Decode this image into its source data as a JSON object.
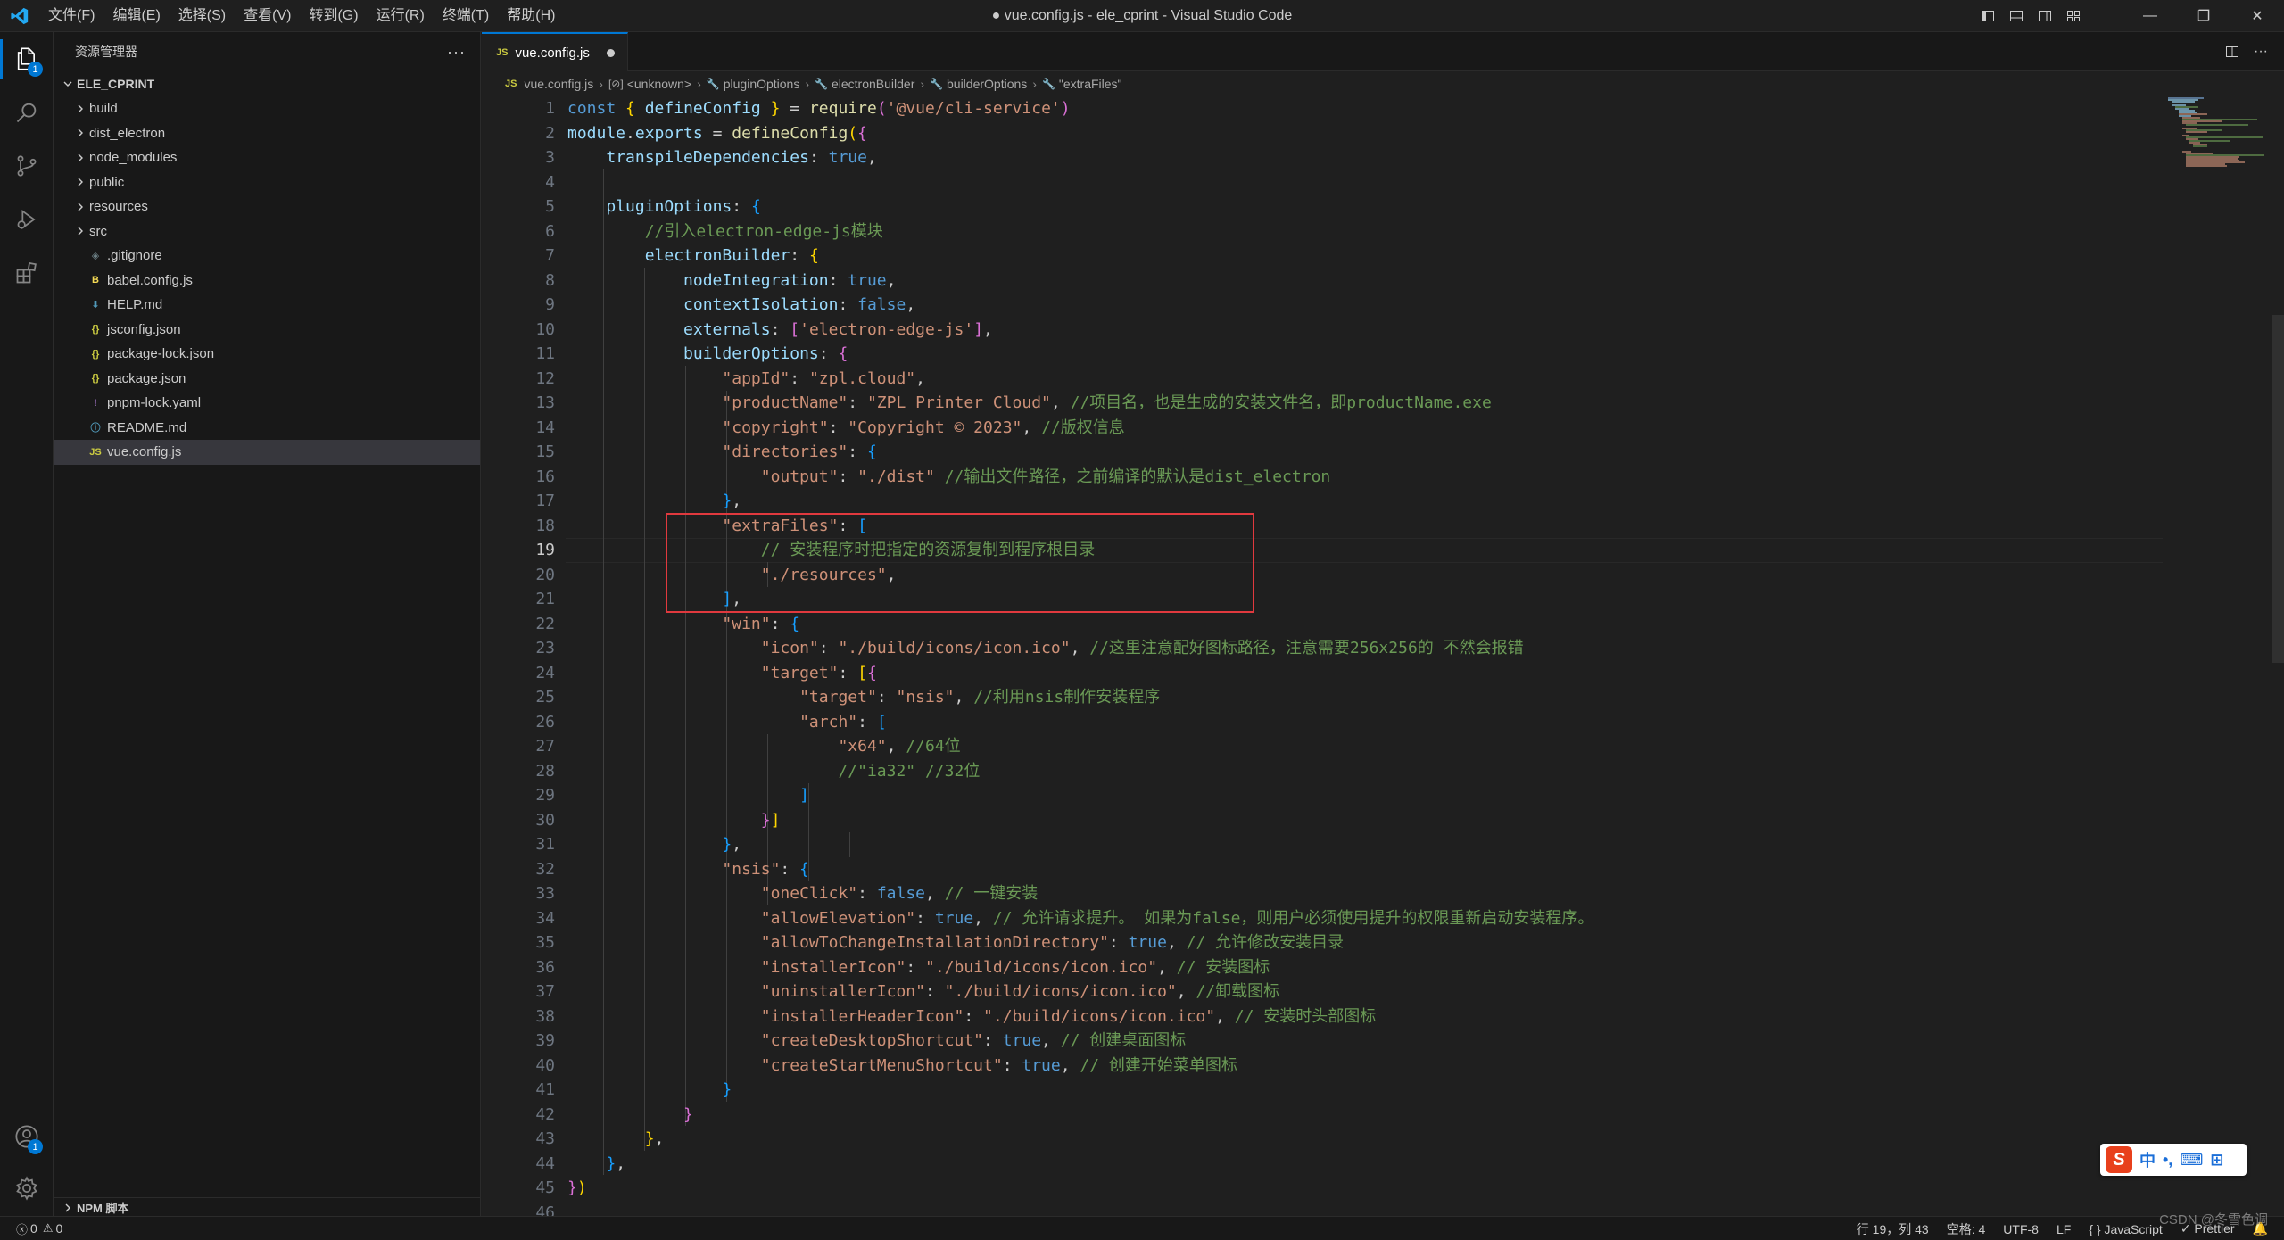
{
  "window": {
    "title": "● vue.config.js - ele_cprint - Visual Studio Code"
  },
  "menu": [
    "文件(F)",
    "编辑(E)",
    "选择(S)",
    "查看(V)",
    "转到(G)",
    "运行(R)",
    "终端(T)",
    "帮助(H)"
  ],
  "window_controls": {
    "minimize": "—",
    "maximize": "❐",
    "close": "✕"
  },
  "activity_bar": {
    "explorer_badge": "1",
    "accounts_badge": "1"
  },
  "sidebar": {
    "header": "资源管理器",
    "more": "···",
    "project": "ELE_CPRINT",
    "folders": [
      "build",
      "dist_electron",
      "node_modules",
      "public",
      "resources",
      "src"
    ],
    "files": [
      {
        "name": ".gitignore",
        "icon": "◈",
        "color": "#6d8086"
      },
      {
        "name": "babel.config.js",
        "icon": "B",
        "color": "#f5da55"
      },
      {
        "name": "HELP.md",
        "icon": "⬇",
        "color": "#519aba"
      },
      {
        "name": "jsconfig.json",
        "icon": "{}",
        "color": "#cbcb41"
      },
      {
        "name": "package-lock.json",
        "icon": "{}",
        "color": "#cbcb41"
      },
      {
        "name": "package.json",
        "icon": "{}",
        "color": "#cbcb41"
      },
      {
        "name": "pnpm-lock.yaml",
        "icon": "!",
        "color": "#a074c4"
      },
      {
        "name": "README.md",
        "icon": "ⓘ",
        "color": "#519aba"
      },
      {
        "name": "vue.config.js",
        "icon": "JS",
        "color": "#cbcb41"
      }
    ],
    "npm_section": "NPM 脚本"
  },
  "tab": {
    "badge": "JS",
    "label": "vue.config.js"
  },
  "breadcrumb": {
    "file": "vue.config.js",
    "items": [
      "<unknown>",
      "pluginOptions",
      "electronBuilder",
      "builderOptions",
      "\"extraFiles\""
    ]
  },
  "editor": {
    "active_line": 19,
    "lines": [
      [
        [
          "k",
          "const "
        ],
        [
          "b1",
          "{ "
        ],
        [
          "v",
          "defineConfig"
        ],
        [
          "b1",
          " }"
        ],
        [
          "p",
          " = "
        ],
        [
          "f",
          "require"
        ],
        [
          "b2",
          "("
        ],
        [
          "s",
          "'@vue/cli-service'"
        ],
        [
          "b2",
          ")"
        ]
      ],
      [
        [
          "v",
          "module"
        ],
        [
          "p",
          "."
        ],
        [
          "v",
          "exports"
        ],
        [
          "p",
          " = "
        ],
        [
          "f",
          "defineConfig"
        ],
        [
          "b1",
          "("
        ],
        [
          "b2",
          "{"
        ]
      ],
      [
        [
          "p",
          "    "
        ],
        [
          "v",
          "transpileDependencies"
        ],
        [
          "p",
          ": "
        ],
        [
          "k",
          "true"
        ],
        [
          "p",
          ","
        ]
      ],
      [],
      [
        [
          "p",
          "    "
        ],
        [
          "v",
          "pluginOptions"
        ],
        [
          "p",
          ": "
        ],
        [
          "b3",
          "{"
        ]
      ],
      [
        [
          "p",
          "        "
        ],
        [
          "c",
          "//引入electron-edge-js模块"
        ]
      ],
      [
        [
          "p",
          "        "
        ],
        [
          "v",
          "electronBuilder"
        ],
        [
          "p",
          ": "
        ],
        [
          "b1",
          "{"
        ]
      ],
      [
        [
          "p",
          "            "
        ],
        [
          "v",
          "nodeIntegration"
        ],
        [
          "p",
          ": "
        ],
        [
          "k",
          "true"
        ],
        [
          "p",
          ","
        ]
      ],
      [
        [
          "p",
          "            "
        ],
        [
          "v",
          "contextIsolation"
        ],
        [
          "p",
          ": "
        ],
        [
          "k",
          "false"
        ],
        [
          "p",
          ","
        ]
      ],
      [
        [
          "p",
          "            "
        ],
        [
          "v",
          "externals"
        ],
        [
          "p",
          ": "
        ],
        [
          "b2",
          "["
        ],
        [
          "s",
          "'electron-edge-js'"
        ],
        [
          "b2",
          "]"
        ],
        [
          "p",
          ","
        ]
      ],
      [
        [
          "p",
          "            "
        ],
        [
          "v",
          "builderOptions"
        ],
        [
          "p",
          ": "
        ],
        [
          "b2",
          "{"
        ]
      ],
      [
        [
          "p",
          "                "
        ],
        [
          "s",
          "\"appId\""
        ],
        [
          "p",
          ": "
        ],
        [
          "s",
          "\"zpl.cloud\""
        ],
        [
          "p",
          ","
        ]
      ],
      [
        [
          "p",
          "                "
        ],
        [
          "s",
          "\"productName\""
        ],
        [
          "p",
          ": "
        ],
        [
          "s",
          "\"ZPL Printer Cloud\""
        ],
        [
          "p",
          ", "
        ],
        [
          "c",
          "//项目名，也是生成的安装文件名，即productName.exe"
        ]
      ],
      [
        [
          "p",
          "                "
        ],
        [
          "s",
          "\"copyright\""
        ],
        [
          "p",
          ": "
        ],
        [
          "s",
          "\"Copyright © 2023\""
        ],
        [
          "p",
          ", "
        ],
        [
          "c",
          "//版权信息"
        ]
      ],
      [
        [
          "p",
          "                "
        ],
        [
          "s",
          "\"directories\""
        ],
        [
          "p",
          ": "
        ],
        [
          "b3",
          "{"
        ]
      ],
      [
        [
          "p",
          "                    "
        ],
        [
          "s",
          "\"output\""
        ],
        [
          "p",
          ": "
        ],
        [
          "s",
          "\"./dist\""
        ],
        [
          "p",
          " "
        ],
        [
          "c",
          "//输出文件路径，之前编译的默认是dist_electron"
        ]
      ],
      [
        [
          "p",
          "                "
        ],
        [
          "b3",
          "}"
        ],
        [
          "p",
          ","
        ]
      ],
      [
        [
          "p",
          "                "
        ],
        [
          "s",
          "\"extraFiles\""
        ],
        [
          "p",
          ": "
        ],
        [
          "b3",
          "["
        ]
      ],
      [
        [
          "p",
          "                    "
        ],
        [
          "c",
          "// 安装程序时把指定的资源复制到程序根目录"
        ]
      ],
      [
        [
          "p",
          "                    "
        ],
        [
          "s",
          "\"./resources\""
        ],
        [
          "p",
          ","
        ]
      ],
      [
        [
          "p",
          "                "
        ],
        [
          "b3",
          "]"
        ],
        [
          "p",
          ","
        ]
      ],
      [
        [
          "p",
          "                "
        ],
        [
          "s",
          "\"win\""
        ],
        [
          "p",
          ": "
        ],
        [
          "b3",
          "{"
        ]
      ],
      [
        [
          "p",
          "                    "
        ],
        [
          "s",
          "\"icon\""
        ],
        [
          "p",
          ": "
        ],
        [
          "s",
          "\"./build/icons/icon.ico\""
        ],
        [
          "p",
          ", "
        ],
        [
          "c",
          "//这里注意配好图标路径，注意需要256x256的 不然会报错"
        ]
      ],
      [
        [
          "p",
          "                    "
        ],
        [
          "s",
          "\"target\""
        ],
        [
          "p",
          ": "
        ],
        [
          "b1",
          "["
        ],
        [
          "b2",
          "{"
        ]
      ],
      [
        [
          "p",
          "                        "
        ],
        [
          "s",
          "\"target\""
        ],
        [
          "p",
          ": "
        ],
        [
          "s",
          "\"nsis\""
        ],
        [
          "p",
          ", "
        ],
        [
          "c",
          "//利用nsis制作安装程序"
        ]
      ],
      [
        [
          "p",
          "                        "
        ],
        [
          "s",
          "\"arch\""
        ],
        [
          "p",
          ": "
        ],
        [
          "b3",
          "["
        ]
      ],
      [
        [
          "p",
          "                            "
        ],
        [
          "s",
          "\"x64\""
        ],
        [
          "p",
          ", "
        ],
        [
          "c",
          "//64位"
        ]
      ],
      [
        [
          "p",
          "                            "
        ],
        [
          "c",
          "//\"ia32\" //32位"
        ]
      ],
      [
        [
          "p",
          "                        "
        ],
        [
          "b3",
          "]"
        ]
      ],
      [
        [
          "p",
          "                    "
        ],
        [
          "b2",
          "}"
        ],
        [
          "b1",
          "]"
        ]
      ],
      [
        [
          "p",
          "                "
        ],
        [
          "b3",
          "}"
        ],
        [
          "p",
          ","
        ]
      ],
      [
        [
          "p",
          "                "
        ],
        [
          "s",
          "\"nsis\""
        ],
        [
          "p",
          ": "
        ],
        [
          "b3",
          "{"
        ]
      ],
      [
        [
          "p",
          "                    "
        ],
        [
          "s",
          "\"oneClick\""
        ],
        [
          "p",
          ": "
        ],
        [
          "k",
          "false"
        ],
        [
          "p",
          ", "
        ],
        [
          "c",
          "// 一键安装"
        ]
      ],
      [
        [
          "p",
          "                    "
        ],
        [
          "s",
          "\"allowElevation\""
        ],
        [
          "p",
          ": "
        ],
        [
          "k",
          "true"
        ],
        [
          "p",
          ", "
        ],
        [
          "c",
          "// 允许请求提升。 如果为false，则用户必须使用提升的权限重新启动安装程序。"
        ]
      ],
      [
        [
          "p",
          "                    "
        ],
        [
          "s",
          "\"allowToChangeInstallationDirectory\""
        ],
        [
          "p",
          ": "
        ],
        [
          "k",
          "true"
        ],
        [
          "p",
          ", "
        ],
        [
          "c",
          "// 允许修改安装目录"
        ]
      ],
      [
        [
          "p",
          "                    "
        ],
        [
          "s",
          "\"installerIcon\""
        ],
        [
          "p",
          ": "
        ],
        [
          "s",
          "\"./build/icons/icon.ico\""
        ],
        [
          "p",
          ", "
        ],
        [
          "c",
          "// 安装图标"
        ]
      ],
      [
        [
          "p",
          "                    "
        ],
        [
          "s",
          "\"uninstallerIcon\""
        ],
        [
          "p",
          ": "
        ],
        [
          "s",
          "\"./build/icons/icon.ico\""
        ],
        [
          "p",
          ", "
        ],
        [
          "c",
          "//卸载图标"
        ]
      ],
      [
        [
          "p",
          "                    "
        ],
        [
          "s",
          "\"installerHeaderIcon\""
        ],
        [
          "p",
          ": "
        ],
        [
          "s",
          "\"./build/icons/icon.ico\""
        ],
        [
          "p",
          ", "
        ],
        [
          "c",
          "// 安装时头部图标"
        ]
      ],
      [
        [
          "p",
          "                    "
        ],
        [
          "s",
          "\"createDesktopShortcut\""
        ],
        [
          "p",
          ": "
        ],
        [
          "k",
          "true"
        ],
        [
          "p",
          ", "
        ],
        [
          "c",
          "// 创建桌面图标"
        ]
      ],
      [
        [
          "p",
          "                    "
        ],
        [
          "s",
          "\"createStartMenuShortcut\""
        ],
        [
          "p",
          ": "
        ],
        [
          "k",
          "true"
        ],
        [
          "p",
          ", "
        ],
        [
          "c",
          "// 创建开始菜单图标"
        ]
      ],
      [
        [
          "p",
          "                "
        ],
        [
          "b3",
          "}"
        ]
      ],
      [
        [
          "p",
          "            "
        ],
        [
          "b2",
          "}"
        ]
      ],
      [
        [
          "p",
          "        "
        ],
        [
          "b1",
          "}"
        ],
        [
          "p",
          ","
        ]
      ],
      [
        [
          "p",
          "    "
        ],
        [
          "b3",
          "}"
        ],
        [
          "p",
          ","
        ]
      ],
      [
        [
          "b2",
          "}"
        ],
        [
          "b1",
          ")"
        ]
      ],
      []
    ]
  },
  "ime": {
    "logo": "S",
    "items": [
      "中",
      "•,",
      "⌨",
      "⊞"
    ]
  },
  "status_bar": {
    "errors": "0",
    "warnings": "0",
    "position": "行 19，列 43",
    "spaces": "空格: 4",
    "encoding": "UTF-8",
    "eol": "LF",
    "language": "{ } JavaScript",
    "formatter": "✓ Prettier"
  },
  "watermark": "CSDN @冬雪色调"
}
